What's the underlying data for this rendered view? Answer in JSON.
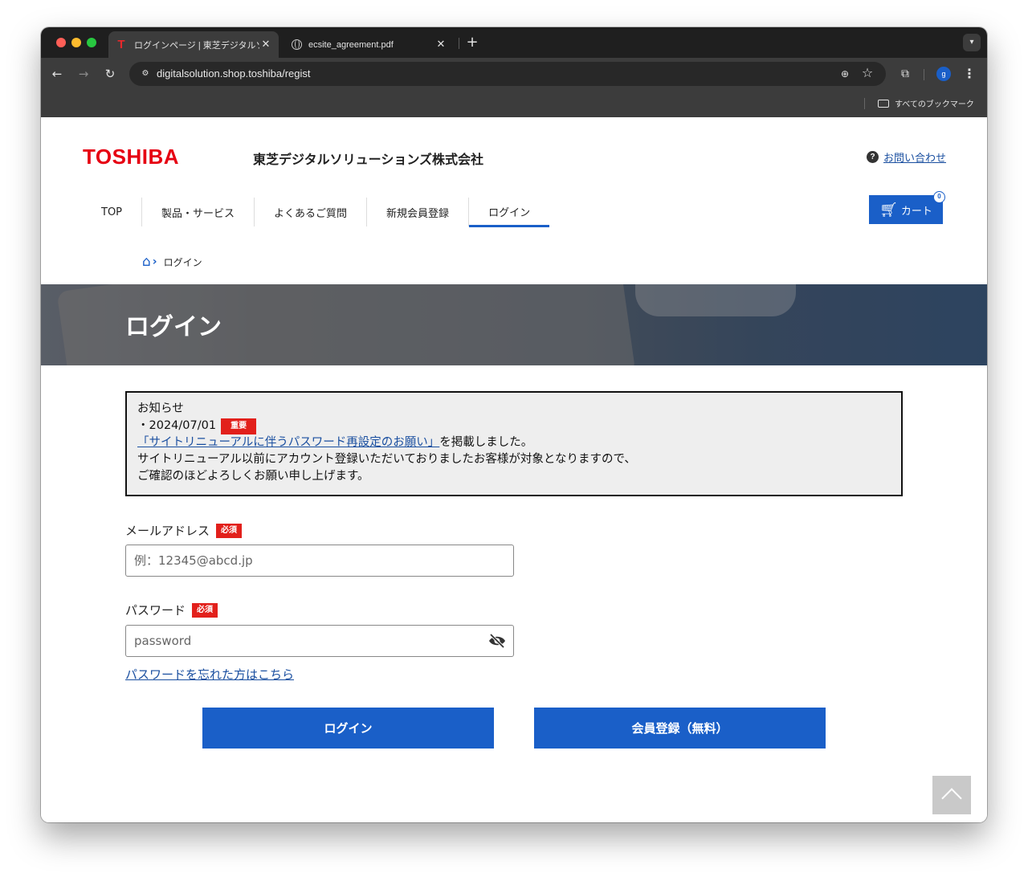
{
  "browser": {
    "tabs": [
      {
        "title": "ログインページ | 東芝デジタルソリ",
        "close": "✕"
      },
      {
        "title": "ecsite_agreement.pdf",
        "close": "✕"
      }
    ],
    "new_tab": "+",
    "url": "digitalsolution.shop.toshiba/regist",
    "profile_initial": "g",
    "bookmarks_label": "すべてのブックマーク"
  },
  "header": {
    "logo": "TOSHIBA",
    "company": "東芝デジタルソリューションズ株式会社",
    "help_label": "お問い合わせ",
    "help_icon": "?"
  },
  "nav": {
    "items": [
      "TOP",
      "製品・サービス",
      "よくあるご質問",
      "新規会員登録",
      "ログイン"
    ],
    "active_index": 4
  },
  "cart": {
    "label": "カート",
    "count": "0"
  },
  "breadcrumb": {
    "current": "ログイン"
  },
  "hero": {
    "title": "ログイン"
  },
  "notice": {
    "heading": "お知らせ",
    "date": "・2024/07/01",
    "badge": "重要",
    "link": "「サイトリニューアルに伴うパスワード再設定のお願い」",
    "link_suffix": "を掲載しました。",
    "line1": "サイトリニューアル以前にアカウント登録いただいておりましたお客様が対象となりますので、",
    "line2": "ご確認のほどよろしくお願い申し上げます。"
  },
  "form": {
    "email_label": "メールアドレス",
    "email_placeholder": "例：12345@abcd.jp",
    "password_label": "パスワード",
    "password_placeholder": "password",
    "required_badge": "必須",
    "forgot_link": "パスワードを忘れた方はこちら",
    "login_button": "ログイン",
    "register_button": "会員登録（無料）"
  },
  "colors": {
    "brand_red": "#e60012",
    "primary_blue": "#1a5fc8",
    "badge_red": "#e2201b",
    "link_blue": "#1a4fa0"
  }
}
